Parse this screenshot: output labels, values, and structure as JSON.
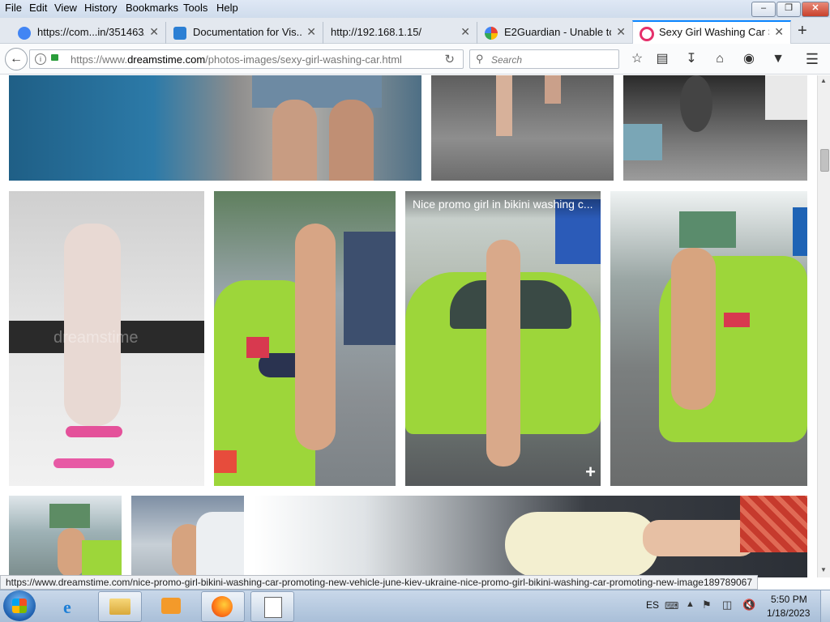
{
  "menu": [
    "File",
    "Edit",
    "View",
    "History",
    "Bookmarks",
    "Tools",
    "Help"
  ],
  "tabs": [
    {
      "label": "https://com...in/351463/",
      "icon": "google-docs-icon"
    },
    {
      "label": "Documentation for Vis...",
      "icon": "vscode-icon"
    },
    {
      "label": "http://192.168.1.15/",
      "icon": ""
    },
    {
      "label": "E2Guardian - Unable to...",
      "icon": "google-icon"
    },
    {
      "label": "Sexy Girl Washing Car S...",
      "icon": "dreamstime-icon",
      "active": true
    }
  ],
  "new_tab": "+",
  "url": {
    "prefix": "https://www.",
    "domain": "dreamstime.com",
    "path": "/photos-images/sexy-girl-washing-car.html"
  },
  "search": {
    "placeholder": "Search"
  },
  "photo_overlay": "Nice promo girl in bikini washing c...",
  "photo_plus": "+",
  "watermark": "dreamstime",
  "status_url": "https://www.dreamstime.com/nice-promo-girl-bikini-washing-car-promoting-new-vehicle-june-kiev-ukraine-nice-promo-girl-bikini-washing-car-promoting-new-image189789067",
  "tray": {
    "lang": "ES",
    "time": "5:50 PM",
    "date": "1/18/2023"
  },
  "colors": {
    "accent": "#0a84ff",
    "lime": "#9dd63a",
    "taskbar": "#b9cce3"
  }
}
